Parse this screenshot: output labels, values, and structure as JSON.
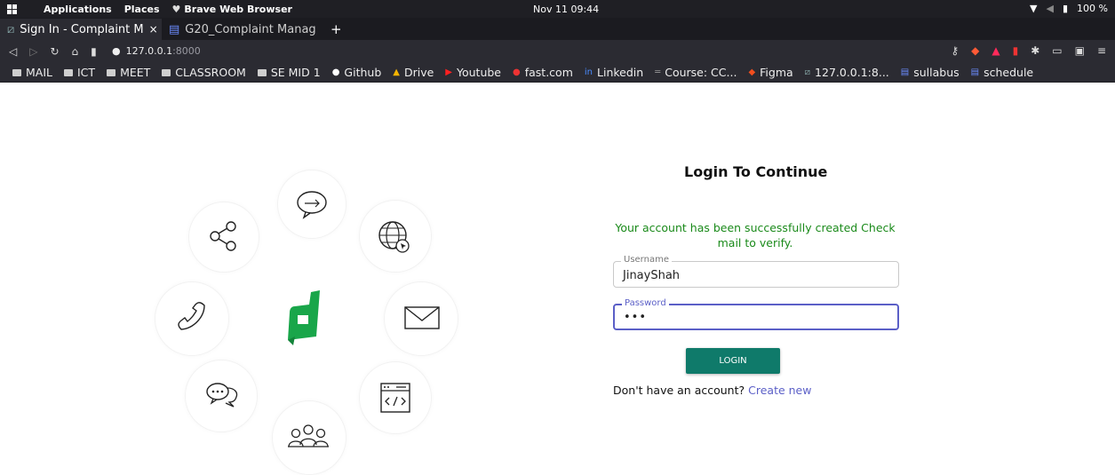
{
  "system_bar": {
    "applications": "Applications",
    "places": "Places",
    "browser_name": "Brave Web Browser",
    "clock": "Nov 11 09:44",
    "battery": "100 %"
  },
  "tabs": [
    {
      "label": "Sign In - Complaint M",
      "active": true
    },
    {
      "label": "G20_Complaint Manag",
      "active": false
    }
  ],
  "new_tab": "+",
  "close_glyph": "×",
  "address": {
    "host": "127.0.0.1",
    "port": ":8000"
  },
  "bookmarks": [
    {
      "label": "MAIL",
      "icon": "folder-icon"
    },
    {
      "label": "ICT",
      "icon": "folder-icon"
    },
    {
      "label": "MEET",
      "icon": "folder-icon"
    },
    {
      "label": "CLASSROOM",
      "icon": "folder-icon"
    },
    {
      "label": "SE MID 1",
      "icon": "folder-icon"
    },
    {
      "label": "Github",
      "icon": "github-icon"
    },
    {
      "label": "Drive",
      "icon": "drive-icon"
    },
    {
      "label": "Youtube",
      "icon": "youtube-icon"
    },
    {
      "label": "fast.com",
      "icon": "fast-icon"
    },
    {
      "label": "Linkedin",
      "icon": "linkedin-icon"
    },
    {
      "label": "Course: CC...",
      "icon": "course-icon"
    },
    {
      "label": "Figma",
      "icon": "figma-icon"
    },
    {
      "label": "127.0.0.1:8...",
      "icon": "site-icon"
    },
    {
      "label": "sullabus",
      "icon": "doc-icon"
    },
    {
      "label": "schedule",
      "icon": "doc-icon"
    }
  ],
  "login": {
    "title": "Login To Continue",
    "message": "Your account has been successfully created Check mail to verify.",
    "username_label": "Username",
    "username_value": "JinayShah",
    "password_label": "Password",
    "password_value": "•••",
    "button": "LOGIN",
    "signup_prompt": "Don't have an account?",
    "signup_link": "Create new"
  },
  "colors": {
    "success": "#1a8a1a",
    "primary_button": "#0f7a6a",
    "focus": "#5b5fc7",
    "logo": "#19a64a"
  }
}
